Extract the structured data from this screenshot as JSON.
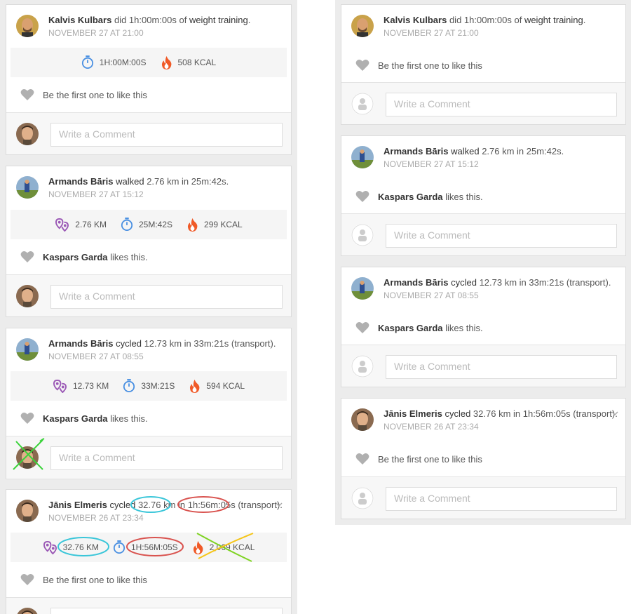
{
  "placeholder": "Write a Comment",
  "colors": {
    "timer": "#4a90e2",
    "fire": "#f05a28",
    "distance": "#9b59b6",
    "heart": "#b0b0b0"
  },
  "left": {
    "cards": [
      {
        "user": "Kalvis Kulbars",
        "verb": "did",
        "detail": " 1h:00m:00s of ",
        "activity": "weight training",
        "tail": ".",
        "date": "NOVEMBER 27 AT 21:00",
        "stats": {
          "time": "1H:00M:00S",
          "kcal": "508 KCAL"
        },
        "like_text": "Be the first one to like this"
      },
      {
        "user": "Armands Bāris",
        "verb": "walked",
        "detail": " 2.76 km in 25m:42s.",
        "date": "NOVEMBER 27 AT 15:12",
        "stats": {
          "distance": "2.76 KM",
          "time": "25M:42S",
          "kcal": "299 KCAL"
        },
        "like_user": "Kaspars Garda",
        "like_suffix": " likes this."
      },
      {
        "user": "Armands Bāris",
        "verb": "cycled",
        "detail": " 12.73 km in 33m:21s (transport).",
        "date": "NOVEMBER 27 AT 08:55",
        "stats": {
          "distance": "12.73 KM",
          "time": "33M:21S",
          "kcal": "594 KCAL"
        },
        "like_user": "Kaspars Garda",
        "like_suffix": " likes this."
      },
      {
        "user": "Jānis Elmeris",
        "verb": "cycled",
        "distance_text": "32.76 km",
        "mid": " in ",
        "time_text": "1h:56m:05s",
        "tail": " (transport).",
        "date": "NOVEMBER 26 AT 23:34",
        "stats": {
          "distance": "32.76 KM",
          "time": "1H:56M:05S",
          "kcal": "2,069 KCAL"
        },
        "like_text": "Be the first one to like this"
      }
    ]
  },
  "right": {
    "cards": [
      {
        "user": "Kalvis Kulbars",
        "verb": "did",
        "detail": " 1h:00m:00s of ",
        "activity": "weight training",
        "tail": ".",
        "date": "NOVEMBER 27 AT 21:00",
        "like_text": "Be the first one to like this"
      },
      {
        "user": "Armands Bāris",
        "verb": "walked",
        "detail": " 2.76 km in 25m:42s.",
        "date": "NOVEMBER 27 AT 15:12",
        "like_user": "Kaspars Garda",
        "like_suffix": " likes this."
      },
      {
        "user": "Armands Bāris",
        "verb": "cycled",
        "detail": " 12.73 km in 33m:21s (transport).",
        "date": "NOVEMBER 27 AT 08:55",
        "like_user": "Kaspars Garda",
        "like_suffix": " likes this."
      },
      {
        "user": "Jānis Elmeris",
        "verb": "cycled",
        "detail": " 32.76 km in 1h:56m:05s (transport).",
        "date": "NOVEMBER 26 AT 23:34",
        "like_text": "Be the first one to like this"
      }
    ]
  }
}
